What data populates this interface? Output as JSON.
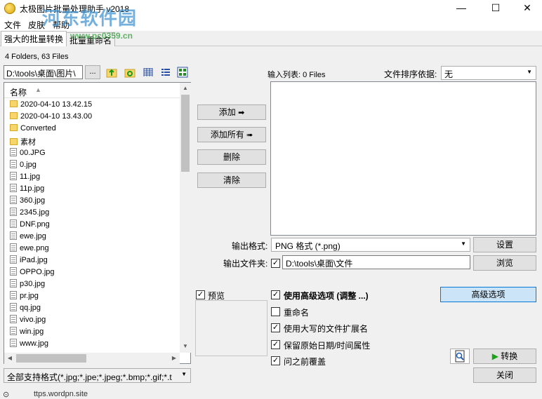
{
  "window": {
    "title": "太极图片批量处理助手  v2018",
    "minimize_glyph": "—",
    "maximize_glyph": "☐",
    "close_glyph": "✕"
  },
  "watermark": {
    "text": "河东软件园",
    "url": "www.pc0359.cn"
  },
  "menu": {
    "items": [
      "文件",
      "皮肤",
      "帮助"
    ]
  },
  "tabs": [
    {
      "label": "强大的批量转换",
      "active": true
    },
    {
      "label": "批量重命名",
      "active": false
    }
  ],
  "browser": {
    "folder_count": "4 Folders, 63 Files",
    "path": "D:\\tools\\桌面\\图片\\",
    "browse_label": "...",
    "column_name": "名称",
    "files": [
      {
        "name": "2020-04-10 13.42.15",
        "type": "folder"
      },
      {
        "name": "2020-04-10 13.43.00",
        "type": "folder"
      },
      {
        "name": "Converted",
        "type": "folder"
      },
      {
        "name": "素材",
        "type": "folder"
      },
      {
        "name": "00.JPG",
        "type": "image"
      },
      {
        "name": "0.jpg",
        "type": "image"
      },
      {
        "name": "11.jpg",
        "type": "image"
      },
      {
        "name": "11p.jpg",
        "type": "image"
      },
      {
        "name": "360.jpg",
        "type": "image"
      },
      {
        "name": "2345.jpg",
        "type": "image"
      },
      {
        "name": "DNF.png",
        "type": "image"
      },
      {
        "name": "ewe.jpg",
        "type": "image"
      },
      {
        "name": "ewe.png",
        "type": "image"
      },
      {
        "name": "iPad.jpg",
        "type": "image"
      },
      {
        "name": "OPPO.jpg",
        "type": "image"
      },
      {
        "name": "p30.jpg",
        "type": "image"
      },
      {
        "name": "pr.jpg",
        "type": "image"
      },
      {
        "name": "qq.jpg",
        "type": "image"
      },
      {
        "name": "vivo.jpg",
        "type": "image"
      },
      {
        "name": "win.jpg",
        "type": "image"
      },
      {
        "name": "www.jpg",
        "type": "image"
      }
    ],
    "filter": "全部支持格式(*.jpg;*.jpe;*.jpeg;*.bmp;*.gif;*.t"
  },
  "actions": {
    "add": "添加",
    "add_all": "添加所有",
    "delete": "删除",
    "clear": "清除"
  },
  "input": {
    "label": "输入列表: 0 Files",
    "sort_label": "文件排序依据:",
    "sort_value": "无"
  },
  "output": {
    "format_label": "输出格式:",
    "format_value": "PNG 格式  (*.png)",
    "settings": "设置",
    "folder_label": "输出文件夹:",
    "folder_checked": true,
    "folder_path": "D:\\tools\\桌面\\文件",
    "browse": "浏览"
  },
  "preview": {
    "label": "预览",
    "checked": true
  },
  "options": [
    {
      "label": "使用高级选项 (调整 ...)",
      "checked": true,
      "bold": true
    },
    {
      "label": "重命名",
      "checked": false,
      "bold": false
    },
    {
      "label": "使用大写的文件扩展名",
      "checked": true,
      "bold": false
    },
    {
      "label": "保留原始日期/时间属性",
      "checked": true,
      "bold": false
    },
    {
      "label": "问之前覆盖",
      "checked": true,
      "bold": false
    }
  ],
  "advanced_button": "高级选项",
  "convert_button": "转换",
  "close_button": "关闭",
  "status": "ttps.wordpn.site",
  "colors": {
    "accent": "#0078d7",
    "convert_arrow": "#1aa31a",
    "folder": "#f7d56b"
  }
}
